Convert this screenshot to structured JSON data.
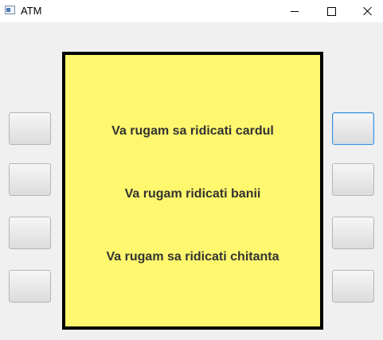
{
  "window": {
    "title": "ATM",
    "controls": [
      "minimize",
      "maximize",
      "close"
    ]
  },
  "screen": {
    "background_color": "#fff86e",
    "messages": [
      "Va rugam sa ridicati cardul",
      "Va rugam ridicati banii",
      "Va rugam sa ridicati chitanta"
    ]
  },
  "side_buttons": {
    "left": [
      "",
      "",
      "",
      ""
    ],
    "right": [
      "",
      "",
      "",
      ""
    ],
    "focused": "right-1"
  }
}
